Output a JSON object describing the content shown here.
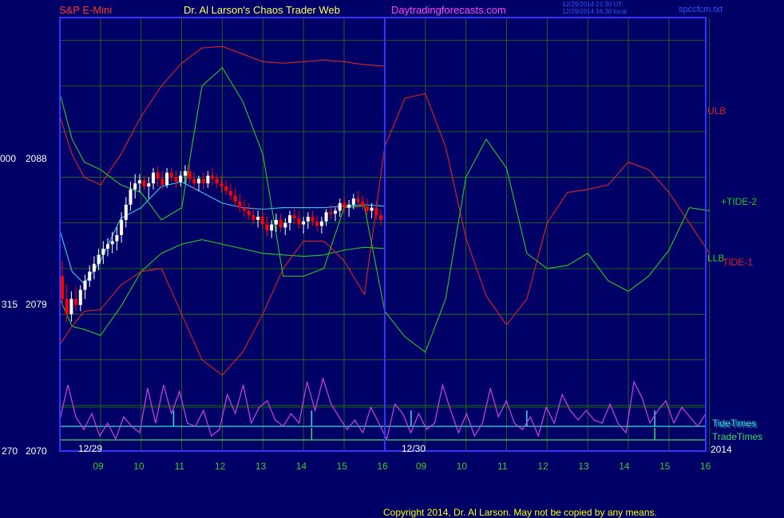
{
  "header": {
    "instrument": "S&P E-Mini",
    "brand": "Dr. Al Larson's Chaos Trader Web",
    "site": "Daytradingforecasts.com",
    "timestamp_ut": "12/29/2014 21:30 UT",
    "timestamp_local": "12/29/2014 16:30 local",
    "file": "spccfcm.txt"
  },
  "colors": {
    "background": "#000066",
    "grid": "#1f5f1f",
    "frame": "#3333ff",
    "price_up": "#ffffff",
    "price_down": "#ff0000",
    "ulb": "#dd2222",
    "llb": "#22cc22",
    "tide1": "#dd2222",
    "tide2": "#22cc22",
    "cycle": "#cc44dd",
    "tidetimes": "#33dddd",
    "tradetimes": "#33dd66"
  },
  "labels": {
    "ulb": "ULB",
    "llb": "LLB",
    "tide1": "TIDE-1",
    "tide2": "+TIDE-2",
    "tidetimes": "TideTimes",
    "tidetimes_overlay": "TideTimes",
    "tradetimes": "TradeTimes",
    "year": "2014",
    "date1": "12/29",
    "date2": "12/30",
    "copyright": "Copyright 2014, Dr. Al Larson. May not be copied by any means."
  },
  "chart_data": {
    "type": "line",
    "y_axis": [
      {
        "left": "000",
        "price": "2088",
        "value": 2088
      },
      {
        "left": "315",
        "price": "2079",
        "value": 2079
      },
      {
        "left": "270",
        "price": "2070",
        "value": 2070
      }
    ],
    "ylim": [
      2070,
      2098.5
    ],
    "x_ticks": [
      "09",
      "10",
      "11",
      "12",
      "13",
      "14",
      "15",
      "16",
      "09",
      "10",
      "11",
      "12",
      "13",
      "14",
      "15",
      "16"
    ],
    "session_dates": [
      "12/29",
      "12/30"
    ],
    "price_bars": [
      [
        2081.5,
        2082.5,
        2079.5,
        2080
      ],
      [
        2080,
        2081,
        2078.5,
        2079
      ],
      [
        2079,
        2080.5,
        2078.5,
        2080
      ],
      [
        2080,
        2080.8,
        2079.2,
        2079.6
      ],
      [
        2079.6,
        2080.9,
        2079.2,
        2080.6
      ],
      [
        2080.6,
        2081.6,
        2080,
        2081.2
      ],
      [
        2081.2,
        2082.2,
        2080.8,
        2081.8
      ],
      [
        2081.8,
        2082.8,
        2081.3,
        2082.3
      ],
      [
        2082.3,
        2083.3,
        2081.9,
        2082.9
      ],
      [
        2082.9,
        2083.8,
        2082.3,
        2083.3
      ],
      [
        2083.3,
        2084,
        2082.8,
        2083.6
      ],
      [
        2083.6,
        2084.4,
        2083,
        2083.8
      ],
      [
        2083.8,
        2084.7,
        2083.2,
        2084.2
      ],
      [
        2084.2,
        2085.7,
        2083.7,
        2085.2
      ],
      [
        2085.2,
        2086.7,
        2084.7,
        2086.2
      ],
      [
        2086.2,
        2087.7,
        2085.8,
        2087.2
      ],
      [
        2087.2,
        2088.2,
        2086.6,
        2087.6
      ],
      [
        2087.6,
        2088.2,
        2087,
        2087.8
      ],
      [
        2087.8,
        2088.1,
        2087.1,
        2087.4
      ],
      [
        2087.4,
        2088,
        2086.6,
        2087.6
      ],
      [
        2087.6,
        2088.6,
        2087.2,
        2088.3
      ],
      [
        2088.3,
        2088.7,
        2087.4,
        2087.9
      ],
      [
        2087.9,
        2088.4,
        2087.2,
        2087.5
      ],
      [
        2087.5,
        2088.6,
        2087.3,
        2088.3
      ],
      [
        2088.3,
        2088.6,
        2087.7,
        2088
      ],
      [
        2088,
        2088.4,
        2087.3,
        2087.7
      ],
      [
        2087.7,
        2088.4,
        2087.4,
        2088.1
      ],
      [
        2088.1,
        2088.8,
        2087.6,
        2088.4
      ],
      [
        2088.4,
        2088.8,
        2087.6,
        2087.9
      ],
      [
        2087.9,
        2088.3,
        2087.2,
        2087.6
      ],
      [
        2087.6,
        2088.1,
        2087.1,
        2087.9
      ],
      [
        2087.9,
        2088.3,
        2087.2,
        2087.6
      ],
      [
        2087.6,
        2088.4,
        2087.3,
        2088.1
      ],
      [
        2088.1,
        2088.6,
        2087.5,
        2087.9
      ],
      [
        2087.9,
        2088.2,
        2087.3,
        2087.6
      ],
      [
        2087.6,
        2088.1,
        2087,
        2087.4
      ],
      [
        2087.4,
        2087.8,
        2086.8,
        2087.1
      ],
      [
        2087.1,
        2087.6,
        2086.5,
        2086.8
      ],
      [
        2086.8,
        2087.3,
        2086.1,
        2086.4
      ],
      [
        2086.4,
        2086.9,
        2085.7,
        2086
      ],
      [
        2086,
        2086.5,
        2085.4,
        2085.8
      ],
      [
        2085.8,
        2086.3,
        2085.2,
        2085.5
      ],
      [
        2085.5,
        2086,
        2084.9,
        2085.2
      ],
      [
        2085.2,
        2085.8,
        2084.7,
        2085.4
      ],
      [
        2085.4,
        2085.8,
        2084.6,
        2084.9
      ],
      [
        2084.9,
        2085.4,
        2084.1,
        2084.5
      ],
      [
        2084.5,
        2085.2,
        2084,
        2084.9
      ],
      [
        2084.9,
        2085.6,
        2084.4,
        2085.2
      ],
      [
        2085.2,
        2085.6,
        2084.4,
        2084.7
      ],
      [
        2084.7,
        2085.3,
        2084.2,
        2085
      ],
      [
        2085,
        2085.8,
        2084.5,
        2085.5
      ],
      [
        2085.5,
        2086,
        2084.9,
        2085.3
      ],
      [
        2085.3,
        2085.8,
        2084.6,
        2084.9
      ],
      [
        2084.9,
        2085.4,
        2084.3,
        2085.1
      ],
      [
        2085.1,
        2085.7,
        2084.6,
        2085.4
      ],
      [
        2085.4,
        2085.8,
        2084.8,
        2085.1
      ],
      [
        2085.1,
        2085.5,
        2084.4,
        2084.8
      ],
      [
        2084.8,
        2085.4,
        2084.3,
        2085.1
      ],
      [
        2085.1,
        2085.9,
        2084.8,
        2085.7
      ],
      [
        2085.7,
        2086.2,
        2085.2,
        2085.6
      ],
      [
        2085.6,
        2086,
        2085.1,
        2085.8
      ],
      [
        2085.8,
        2086.6,
        2085.4,
        2086.3
      ],
      [
        2086.3,
        2086.7,
        2085.6,
        2086
      ],
      [
        2086,
        2086.5,
        2085.4,
        2086.2
      ],
      [
        2086.2,
        2086.9,
        2085.9,
        2086.6
      ],
      [
        2086.6,
        2087.1,
        2086,
        2086.4
      ],
      [
        2086.4,
        2086.8,
        2085.8,
        2086.1
      ],
      [
        2086.1,
        2086.6,
        2085.5,
        2085.8
      ],
      [
        2085.8,
        2086.3,
        2085.3,
        2086
      ],
      [
        2086,
        2086.4,
        2085.2,
        2085.5
      ],
      [
        2085.5,
        2085.9,
        2084.8,
        2085.2
      ]
    ],
    "series": [
      {
        "name": "ULB",
        "x": [
          0,
          0.3,
          0.6,
          1,
          1.5,
          2,
          2.5,
          3,
          3.5,
          4,
          4.5,
          5,
          5.5,
          6,
          6.5,
          7,
          7.5,
          8
        ],
        "y": [
          2092,
          2089.5,
          2088,
          2087.5,
          2089.5,
          2092,
          2094,
          2095.5,
          2096.5,
          2096.6,
          2096.1,
          2095.6,
          2095.5,
          2095.6,
          2095.7,
          2095.6,
          2095.4,
          2095.3
        ]
      },
      {
        "name": "LLB",
        "x": [
          0,
          0.3,
          0.6,
          1,
          1.5,
          2,
          2.5,
          3,
          3.5,
          4,
          4.5,
          5,
          5.5,
          6,
          6.5,
          7,
          7.5,
          8
        ],
        "y": [
          2080,
          2078.2,
          2078,
          2077.6,
          2079.5,
          2081.8,
          2083,
          2083.6,
          2083.9,
          2083.6,
          2083.3,
          2083,
          2082.9,
          2082.8,
          2082.9,
          2083.2,
          2083.4,
          2083.3
        ]
      },
      {
        "name": "TIDE-1",
        "x": [
          0,
          0.3,
          0.6,
          1,
          1.5,
          2,
          2.5,
          3,
          3.5,
          4,
          4.5,
          5,
          5.5,
          6,
          6.5,
          7,
          7.5,
          8,
          8.5,
          9,
          9.5,
          10,
          10.5,
          11,
          11.5,
          12,
          12.5,
          13,
          13.5,
          14,
          14.5,
          15,
          15.5,
          16
        ],
        "y": [
          2077,
          2078.2,
          2079.2,
          2079.3,
          2080.9,
          2081.8,
          2082,
          2079,
          2076,
          2075,
          2076.5,
          2079,
          2082,
          2083.8,
          2083.8,
          2082.5,
          2080.3,
          2090,
          2093.2,
          2093.5,
          2090,
          2084,
          2080.2,
          2078.3,
          2080,
          2085,
          2087,
          2087.2,
          2087.5,
          2089,
          2088.5,
          2087,
          2085,
          2083
        ]
      },
      {
        "name": "TIDE-2",
        "x": [
          0,
          0.3,
          0.6,
          1,
          1.5,
          2,
          2.5,
          3,
          3.5,
          4,
          4.5,
          5,
          5.5,
          6,
          6.5,
          7,
          7.5,
          8,
          8.5,
          9,
          9.5,
          10,
          10.5,
          11,
          11.5,
          12,
          12.5,
          13,
          13.5,
          14,
          14.5,
          15,
          15.5,
          16
        ],
        "y": [
          2093.5,
          2090.5,
          2089,
          2088.5,
          2087.5,
          2087,
          2085.2,
          2086,
          2094,
          2095.2,
          2093,
          2089.5,
          2081.5,
          2081.5,
          2082,
          2086,
          2086.1,
          2079.2,
          2077.5,
          2076.5,
          2080,
          2088,
          2090.5,
          2088.6,
          2083,
          2082,
          2082.2,
          2083,
          2081.2,
          2080.5,
          2081.5,
          2083.2,
          2086,
          2085.8
        ]
      },
      {
        "name": "Average",
        "x": [
          0,
          0.3,
          0.6,
          1,
          1.5,
          2,
          2.5,
          3,
          3.5,
          4,
          4.5,
          5,
          5.5,
          6,
          6.5,
          7,
          7.5,
          8
        ],
        "y": [
          2084.5,
          2081.8,
          2081,
          2082.5,
          2085.3,
          2086,
          2087.4,
          2087.7,
          2087,
          2086.3,
          2086,
          2085.9,
          2086,
          2086,
          2086,
          2086.1,
          2086.2,
          2086.1
        ]
      },
      {
        "name": "Cycle",
        "values": [
          0.35,
          0.9,
          0.4,
          0.2,
          0.45,
          0.1,
          0.3,
          0.05,
          0.4,
          0.25,
          0.15,
          0.85,
          0.3,
          0.9,
          0.45,
          0.8,
          0.3,
          0.25,
          0.5,
          0.1,
          0.2,
          0.75,
          0.45,
          0.9,
          0.3,
          0.55,
          0.65,
          0.35,
          0.25,
          0.45,
          0.3,
          0.95,
          0.5,
          1,
          0.6,
          0.4,
          0.2,
          0.35,
          0.15,
          0.55,
          0.3,
          0.05,
          0.6,
          0.45,
          0.15,
          0.45,
          0.2,
          0.3,
          0.9,
          0.5,
          0.15,
          0.45,
          0.1,
          0.3,
          0.85,
          0.4,
          0.65,
          0.3,
          0.2,
          0.4,
          0.1,
          0.55,
          0.3,
          0.75,
          0.5,
          0.35,
          0.5,
          0.35,
          0.3,
          0.6,
          0.3,
          0.15,
          0.95,
          0.7,
          0.3,
          0.5,
          0.65,
          0.3,
          0.55,
          0.4,
          0.25,
          0.45
        ]
      }
    ],
    "tide_times": [
      2.8,
      6.2,
      8.65,
      11.5,
      14.65
    ],
    "trade_times": [
      6.2,
      14.65
    ]
  }
}
